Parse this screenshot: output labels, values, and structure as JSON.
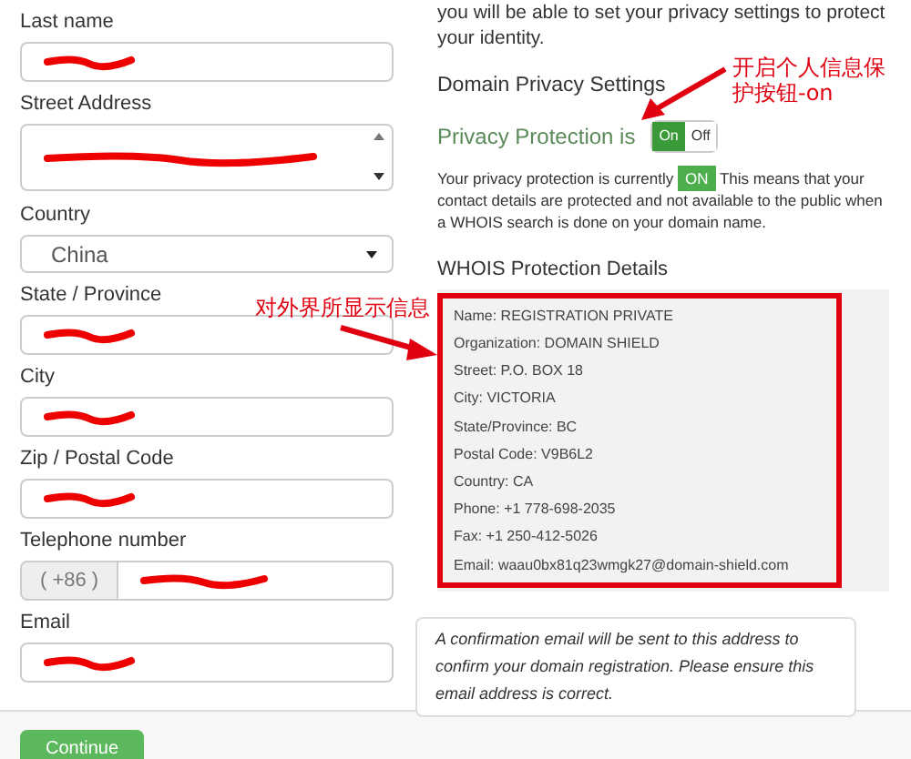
{
  "form": {
    "fields": [
      {
        "label": "Last name",
        "kind": "text",
        "redacted": true
      },
      {
        "label": "Street Address",
        "kind": "textarea",
        "redacted": true
      },
      {
        "label": "Country",
        "kind": "select",
        "value": "China"
      },
      {
        "label": "State / Province",
        "kind": "text",
        "redacted": true
      },
      {
        "label": "City",
        "kind": "text",
        "redacted": true
      },
      {
        "label": "Zip / Postal Code",
        "kind": "text",
        "redacted": true
      },
      {
        "label": "Telephone number",
        "kind": "phone",
        "prefix": "( +86 )",
        "redacted": true
      },
      {
        "label": "Email",
        "kind": "text",
        "redacted": true
      }
    ],
    "continue_button": "Continue"
  },
  "privacy": {
    "intro": "you will be able to set your privacy settings to protect your identity.",
    "heading": "Domain Privacy Settings",
    "toggle_label": "Privacy Protection is",
    "toggle": {
      "on_label": "On",
      "off_label": "Off",
      "on": true
    },
    "status_before": "Your privacy protection is currently",
    "status_badge": "ON",
    "status_after": "This means that your contact details are protected and not available to the public when a WHOIS search is done on your domain name.",
    "whois_heading": "WHOIS Protection Details",
    "whois_lines": [
      "Name: REGISTRATION PRIVATE",
      "Organization: DOMAIN SHIELD",
      "Street: P.O. BOX 18",
      "City: VICTORIA",
      "State/Province: BC",
      "Postal Code: V9B6L2",
      "Country: CA",
      "Phone: +1 778-698-2035",
      "Fax: +1 250-412-5026",
      "Email: waau0bx81q23wmgk27@domain-shield.com"
    ],
    "email_note": "A confirmation email will be sent to this address to confirm your domain registration. Please ensure this email address is correct."
  },
  "annotations": [
    "开启个人信息保护按钮-on",
    "对外界所显示信息"
  ]
}
